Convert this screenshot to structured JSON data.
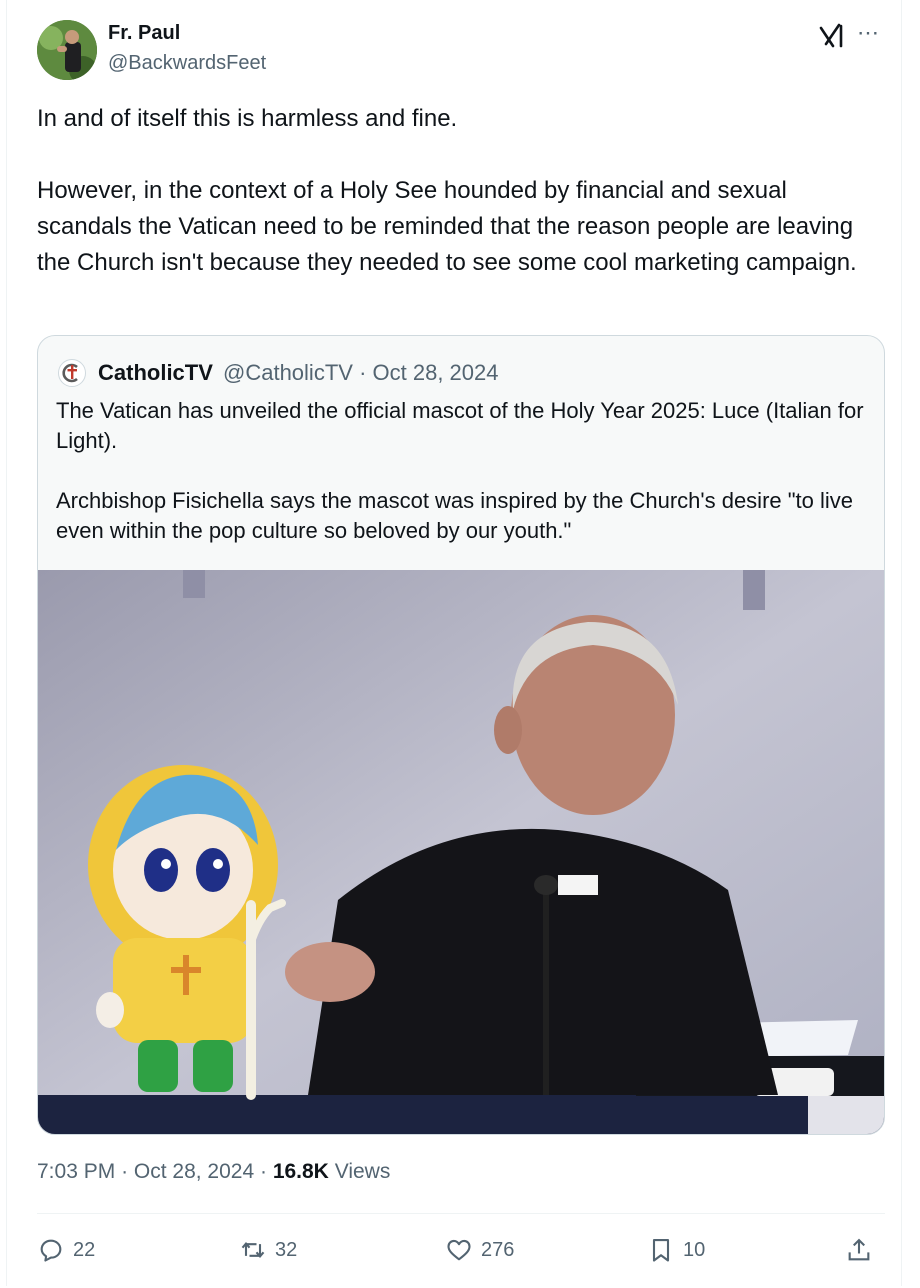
{
  "tweet": {
    "author_name": "Fr. Paul",
    "author_handle": "@BackwardsFeet",
    "text": "In and of itself this is harmless and fine.\n\nHowever, in the context of a Holy See hounded by financial and sexual scandals the Vatican need to be reminded that the reason people are leaving the Church isn't because they needed to see some cool marketing campaign.",
    "time": "7:03 PM",
    "date": "Oct 28, 2024",
    "views_count": "16.8K",
    "views_label": "Views"
  },
  "quote": {
    "author_name": "CatholicTV",
    "author_handle": "@CatholicTV",
    "date": "Oct 28, 2024",
    "text": "The Vatican has unveiled the official mascot of the Holy Year 2025: Luce (Italian for Light).\n\nArchbishop Fisichella says the mascot was inspired by the Church's desire \"to live even within the pop culture so beloved by our youth.\""
  },
  "actions": {
    "replies": "22",
    "reposts": "32",
    "likes": "276",
    "bookmarks": "10"
  },
  "icons": [
    "grok-icon",
    "more-icon",
    "reply-icon",
    "repost-icon",
    "like-icon",
    "bookmark-icon",
    "share-icon"
  ],
  "colors": {
    "text": "#0f1419",
    "secondary": "#536471",
    "border": "#cfd9de",
    "quote_bg": "#f7f9f9"
  }
}
